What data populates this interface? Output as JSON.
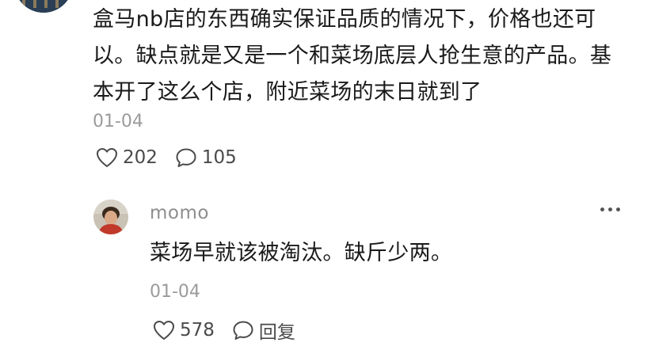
{
  "main_comment": {
    "text": "盒马nb店的东西确实保证品质的情况下，价格也还可以。缺点就是又是一个和菜场底层人抢生意的产品。基本开了这么个店，附近菜场的末日就到了",
    "date": "01-04",
    "likes": "202",
    "replies": "105",
    "icons": {
      "like": "heart-outline-icon",
      "comment": "speech-bubble-icon"
    }
  },
  "reply": {
    "username": "momo",
    "text": "菜场早就该被淘汰。缺斤少两。",
    "date": "01-04",
    "likes": "578",
    "reply_label": "回复",
    "icons": {
      "more": "more-horizontal-icon",
      "like": "heart-outline-icon",
      "reply": "speech-bubble-icon"
    }
  },
  "colors": {
    "text": "#1a1a1a",
    "muted": "#9b9b9b",
    "action": "#4a4a4a"
  }
}
